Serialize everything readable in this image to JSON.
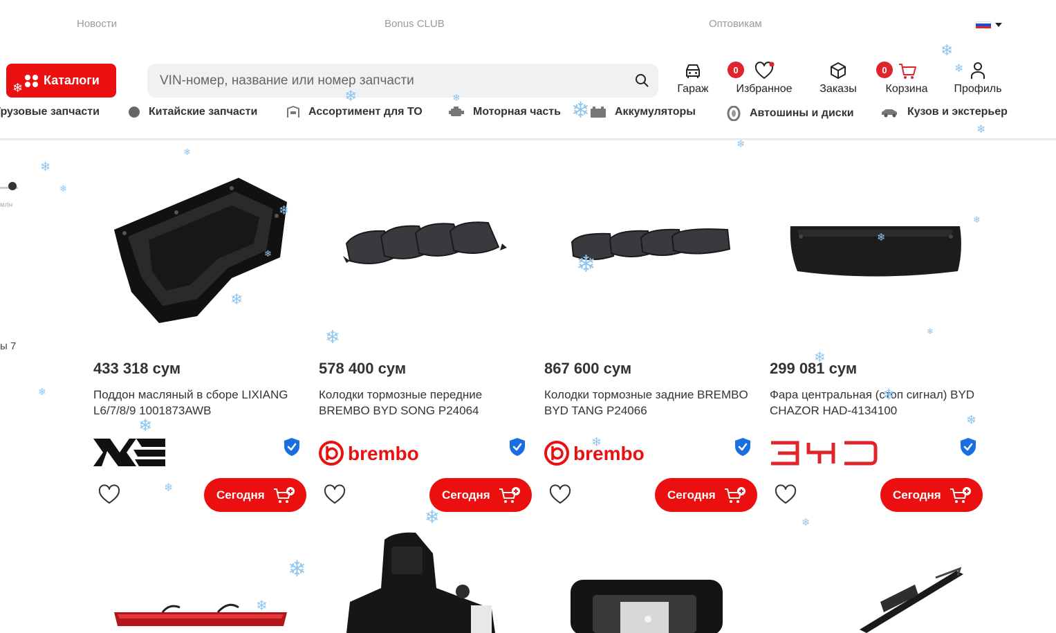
{
  "top_links": [
    "Новости",
    "Bonus CLUB",
    "Оптовикам"
  ],
  "catalog_button": "Каталоги",
  "search": {
    "placeholder": "VIN-номер, название или номер запчасти"
  },
  "header_actions": {
    "garage": "Гараж",
    "favorites": "Избранное",
    "favorites_count": "0",
    "orders": "Заказы",
    "cart": "Корзина",
    "cart_count": "0",
    "profile": "Профиль"
  },
  "categories": [
    "Грузовые запчасти",
    "Китайские запчасти",
    "Ассортимент для ТО",
    "Моторная часть",
    "Аккумуляторы",
    "Автошины и диски",
    "Кузов и экстерьер"
  ],
  "sidebar": {
    "slider_unit": "млн",
    "count_text": "ы 7"
  },
  "products": [
    {
      "price": "433 318 сум",
      "title": "Поддон масляный в сборе LIXIANG L6/7/8/9 1001873AWB",
      "brand": "lixiang-logo",
      "button": "Сегодня"
    },
    {
      "price": "578 400 сум",
      "title": "Колодки тормозные передние BREMBO BYD SONG P24064",
      "brand": "brembo",
      "button": "Сегодня"
    },
    {
      "price": "867 600 сум",
      "title": "Колодки тормозные задние BREMBO BYD TANG P24066",
      "brand": "brembo",
      "button": "Сегодня"
    },
    {
      "price": "299 081 сум",
      "title": "Фара центральная (стоп сигнал) BYD CHAZOR HAD-4134100",
      "brand": "byd-logo",
      "button": "Сегодня"
    }
  ],
  "colors": {
    "accent": "#ec0f0f",
    "badge": "#e0242b",
    "verified": "#1a6fe0"
  }
}
